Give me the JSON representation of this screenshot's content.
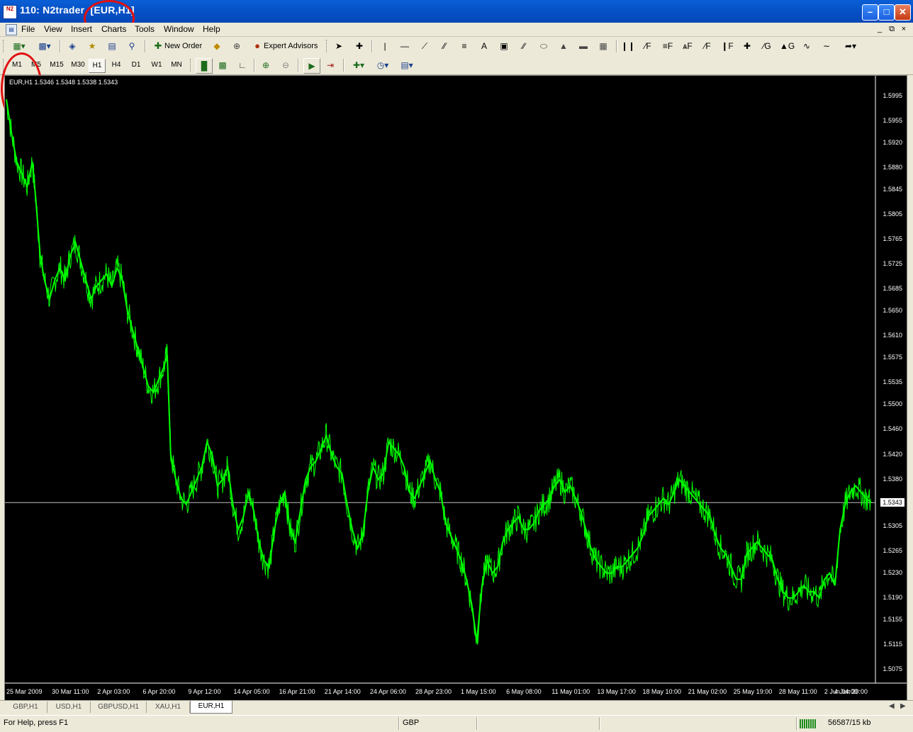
{
  "window": {
    "title": "110: N2trader",
    "chart_tag": "[EUR,H1]",
    "icon_text": "N2"
  },
  "menu": [
    "File",
    "View",
    "Insert",
    "Charts",
    "Tools",
    "Window",
    "Help"
  ],
  "toolbar": {
    "new_order_label": "New Order",
    "expert_advisors_label": "Expert Advisors"
  },
  "timeframes": [
    "M1",
    "M5",
    "M15",
    "M30",
    "H1",
    "H4",
    "D1",
    "W1",
    "MN"
  ],
  "active_timeframe": "H1",
  "chart": {
    "symbol_info": "EUR,H1",
    "ohlc": "1.5346 1.5348 1.5338 1.5343",
    "current_price": "1.5343",
    "line_color": "#00ff00",
    "background": "#000000"
  },
  "chart_data": {
    "type": "line",
    "y_ticks": [
      "1.5995",
      "1.5955",
      "1.5920",
      "1.5880",
      "1.5845",
      "1.5805",
      "1.5765",
      "1.5725",
      "1.5685",
      "1.5650",
      "1.5610",
      "1.5575",
      "1.5535",
      "1.5500",
      "1.5460",
      "1.5420",
      "1.5380",
      "1.5343",
      "1.5305",
      "1.5265",
      "1.5230",
      "1.5190",
      "1.5155",
      "1.5115",
      "1.5075"
    ],
    "x_ticks": [
      "25 Mar 2009",
      "30 Mar 11:00",
      "2 Apr 03:00",
      "6 Apr 20:00",
      "9 Apr 12:00",
      "14 Apr 05:00",
      "16 Apr 21:00",
      "21 Apr 14:00",
      "24 Apr 06:00",
      "28 Apr 23:00",
      "1 May 15:00",
      "6 May 08:00",
      "11 May 01:00",
      "13 May 17:00",
      "18 May 10:00",
      "21 May 02:00",
      "25 May 19:00",
      "28 May 11:00",
      "2 Jun 04:00",
      "4 Jun 20:00"
    ],
    "ylim": [
      1.5075,
      1.6005
    ],
    "current": 1.5343,
    "series": [
      {
        "points": [
          [
            0,
            1.599
          ],
          [
            0.6,
            1.5935
          ],
          [
            1.2,
            1.589
          ],
          [
            1.8,
            1.587
          ],
          [
            2.4,
            1.585
          ],
          [
            3.0,
            1.589
          ],
          [
            3.4,
            1.583
          ],
          [
            3.9,
            1.574
          ],
          [
            4.4,
            1.57
          ],
          [
            5.0,
            1.567
          ],
          [
            5.6,
            1.57
          ],
          [
            6.2,
            1.572
          ],
          [
            6.8,
            1.57
          ],
          [
            7.4,
            1.574
          ],
          [
            8.0,
            1.576
          ],
          [
            8.6,
            1.573
          ],
          [
            9.2,
            1.57
          ],
          [
            9.8,
            1.567
          ],
          [
            10.4,
            1.569
          ],
          [
            11.0,
            1.57
          ],
          [
            11.6,
            1.571
          ],
          [
            12.2,
            1.569
          ],
          [
            12.8,
            1.572
          ],
          [
            13.4,
            1.57
          ],
          [
            14.0,
            1.565
          ],
          [
            14.6,
            1.562
          ],
          [
            15.2,
            1.559
          ],
          [
            15.8,
            1.556
          ],
          [
            16.4,
            1.553
          ],
          [
            17.0,
            1.552
          ],
          [
            17.6,
            1.554
          ],
          [
            18.2,
            1.556
          ],
          [
            18.6,
            1.558
          ],
          [
            19.0,
            1.542
          ],
          [
            19.6,
            1.538
          ],
          [
            20.2,
            1.535
          ],
          [
            20.8,
            1.534
          ],
          [
            21.4,
            1.536
          ],
          [
            22.0,
            1.538
          ],
          [
            22.6,
            1.54
          ],
          [
            23.2,
            1.544
          ],
          [
            23.8,
            1.542
          ],
          [
            24.4,
            1.537
          ],
          [
            25.0,
            1.538
          ],
          [
            25.6,
            1.54
          ],
          [
            26.2,
            1.534
          ],
          [
            26.8,
            1.53
          ],
          [
            27.4,
            1.532
          ],
          [
            28.0,
            1.536
          ],
          [
            28.6,
            1.533
          ],
          [
            29.2,
            1.528
          ],
          [
            29.8,
            1.525
          ],
          [
            30.4,
            1.524
          ],
          [
            31.0,
            1.53
          ],
          [
            31.6,
            1.534
          ],
          [
            32.2,
            1.536
          ],
          [
            32.8,
            1.53
          ],
          [
            33.4,
            1.528
          ],
          [
            34.0,
            1.533
          ],
          [
            34.6,
            1.538
          ],
          [
            35.2,
            1.54
          ],
          [
            35.8,
            1.541
          ],
          [
            36.4,
            1.543
          ],
          [
            37.0,
            1.545
          ],
          [
            37.6,
            1.542
          ],
          [
            38.2,
            1.54
          ],
          [
            38.8,
            1.539
          ],
          [
            39.4,
            1.534
          ],
          [
            40.0,
            1.53
          ],
          [
            40.6,
            1.527
          ],
          [
            41.2,
            1.529
          ],
          [
            41.8,
            1.536
          ],
          [
            42.4,
            1.54
          ],
          [
            43.0,
            1.538
          ],
          [
            43.6,
            1.539
          ],
          [
            44.2,
            1.544
          ],
          [
            44.8,
            1.543
          ],
          [
            45.4,
            1.542
          ],
          [
            46.0,
            1.54
          ],
          [
            46.6,
            1.536
          ],
          [
            47.2,
            1.535
          ],
          [
            47.8,
            1.537
          ],
          [
            48.4,
            1.539
          ],
          [
            49.0,
            1.541
          ],
          [
            49.6,
            1.538
          ],
          [
            50.2,
            1.536
          ],
          [
            50.8,
            1.531
          ],
          [
            51.4,
            1.529
          ],
          [
            52.0,
            1.527
          ],
          [
            52.6,
            1.525
          ],
          [
            53.2,
            1.522
          ],
          [
            53.8,
            1.518
          ],
          [
            54.4,
            1.512
          ],
          [
            55.0,
            1.521
          ],
          [
            55.6,
            1.525
          ],
          [
            56.2,
            1.523
          ],
          [
            56.8,
            1.524
          ],
          [
            57.4,
            1.528
          ],
          [
            58.0,
            1.53
          ],
          [
            58.6,
            1.531
          ],
          [
            59.2,
            1.532
          ],
          [
            59.8,
            1.53
          ],
          [
            60.4,
            1.53
          ],
          [
            61.0,
            1.531
          ],
          [
            61.6,
            1.533
          ],
          [
            62.2,
            1.534
          ],
          [
            62.8,
            1.535
          ],
          [
            63.4,
            1.537
          ],
          [
            64.0,
            1.538
          ],
          [
            64.6,
            1.536
          ],
          [
            65.2,
            1.537
          ],
          [
            65.8,
            1.535
          ],
          [
            66.4,
            1.533
          ],
          [
            67.0,
            1.53
          ],
          [
            67.6,
            1.527
          ],
          [
            68.2,
            1.525
          ],
          [
            68.8,
            1.524
          ],
          [
            69.4,
            1.523
          ],
          [
            70.0,
            1.523
          ],
          [
            70.6,
            1.524
          ],
          [
            71.2,
            1.524
          ],
          [
            71.8,
            1.525
          ],
          [
            72.4,
            1.526
          ],
          [
            73.0,
            1.527
          ],
          [
            73.6,
            1.529
          ],
          [
            74.2,
            1.532
          ],
          [
            74.8,
            1.533
          ],
          [
            75.4,
            1.534
          ],
          [
            76.0,
            1.535
          ],
          [
            76.6,
            1.534
          ],
          [
            77.2,
            1.536
          ],
          [
            77.8,
            1.538
          ],
          [
            78.4,
            1.537
          ],
          [
            79.0,
            1.536
          ],
          [
            79.6,
            1.535
          ],
          [
            80.2,
            1.534
          ],
          [
            80.8,
            1.533
          ],
          [
            81.4,
            1.532
          ],
          [
            82.0,
            1.529
          ],
          [
            82.6,
            1.527
          ],
          [
            83.2,
            1.526
          ],
          [
            83.8,
            1.524
          ],
          [
            84.4,
            1.522
          ],
          [
            85.0,
            1.522
          ],
          [
            85.6,
            1.526
          ],
          [
            86.2,
            1.527
          ],
          [
            86.8,
            1.528
          ],
          [
            87.4,
            1.527
          ],
          [
            88.0,
            1.526
          ],
          [
            88.6,
            1.525
          ],
          [
            89.2,
            1.522
          ],
          [
            89.8,
            1.52
          ],
          [
            90.4,
            1.519
          ],
          [
            91.0,
            1.519
          ],
          [
            91.6,
            1.52
          ],
          [
            92.2,
            1.521
          ],
          [
            92.8,
            1.52
          ],
          [
            93.4,
            1.52
          ],
          [
            94.0,
            1.519
          ],
          [
            94.6,
            1.522
          ],
          [
            95.2,
            1.523
          ],
          [
            95.8,
            1.521
          ],
          [
            96.4,
            1.53
          ],
          [
            97.0,
            1.534
          ],
          [
            97.6,
            1.536
          ],
          [
            98.2,
            1.537
          ],
          [
            98.8,
            1.536
          ],
          [
            99.4,
            1.535
          ],
          [
            100,
            1.5343
          ]
        ]
      }
    ]
  },
  "tabs": [
    "GBP,H1",
    "USD,H1",
    "GBPUSD,H1",
    "XAU,H1",
    "EUR,H1"
  ],
  "active_tab": "EUR,H1",
  "status": {
    "help": "For Help, press F1",
    "profile": "GBP",
    "traffic": "56587/15 kb"
  }
}
